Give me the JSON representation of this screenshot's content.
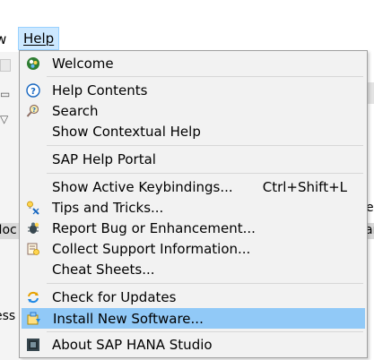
{
  "menubar": {
    "view_fragment": "w",
    "help_label": "Help"
  },
  "background": {
    "left_fragment_1": "Noc",
    "left_fragment_2": "ess",
    "right_fragment_1": "e",
    "right_fragment_2": "ar"
  },
  "help_menu": {
    "items": [
      {
        "label": "Welcome",
        "icon": "welcome-icon"
      },
      {
        "label": "Help Contents",
        "icon": "help-contents-icon"
      },
      {
        "label": "Search",
        "icon": "search-help-icon"
      },
      {
        "label": "Show Contextual Help",
        "icon": ""
      },
      {
        "label": "SAP Help Portal",
        "icon": ""
      },
      {
        "label": "Show Active Keybindings...",
        "accelerator": "Ctrl+Shift+L",
        "icon": ""
      },
      {
        "label": "Tips and Tricks...",
        "icon": "tips-icon"
      },
      {
        "label": "Report Bug or Enhancement...",
        "icon": "bug-icon"
      },
      {
        "label": "Collect Support Information...",
        "icon": "support-icon"
      },
      {
        "label": "Cheat Sheets...",
        "icon": ""
      },
      {
        "label": "Check for Updates",
        "icon": "update-icon"
      },
      {
        "label": "Install New Software...",
        "icon": "install-icon",
        "highlighted": true
      },
      {
        "label": "About SAP HANA Studio",
        "icon": "about-icon"
      }
    ]
  },
  "colors": {
    "menu_bg": "#f2f2f2",
    "highlight": "#91c9f7",
    "menubar_active": "#cce8ff"
  }
}
